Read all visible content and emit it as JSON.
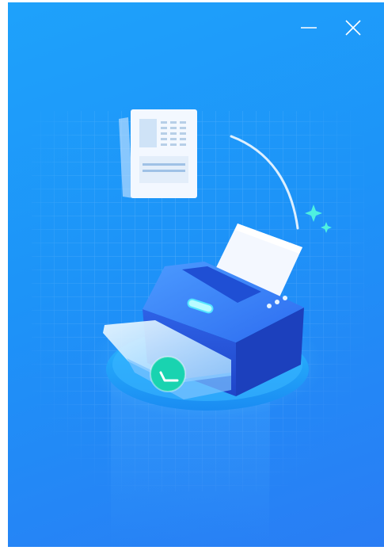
{
  "window": {
    "controls": [
      {
        "id": "minimize",
        "icon": "minimize-icon"
      },
      {
        "id": "close",
        "icon": "close-icon"
      }
    ]
  },
  "illustration": {
    "subject": "printer-with-document",
    "colors": {
      "background_start": "#1ea2fb",
      "background_end": "#2a7cf4",
      "printer_body": "#2f6cf0",
      "check_badge": "#19d3b0",
      "sparkle": "#4ef0e0"
    }
  }
}
